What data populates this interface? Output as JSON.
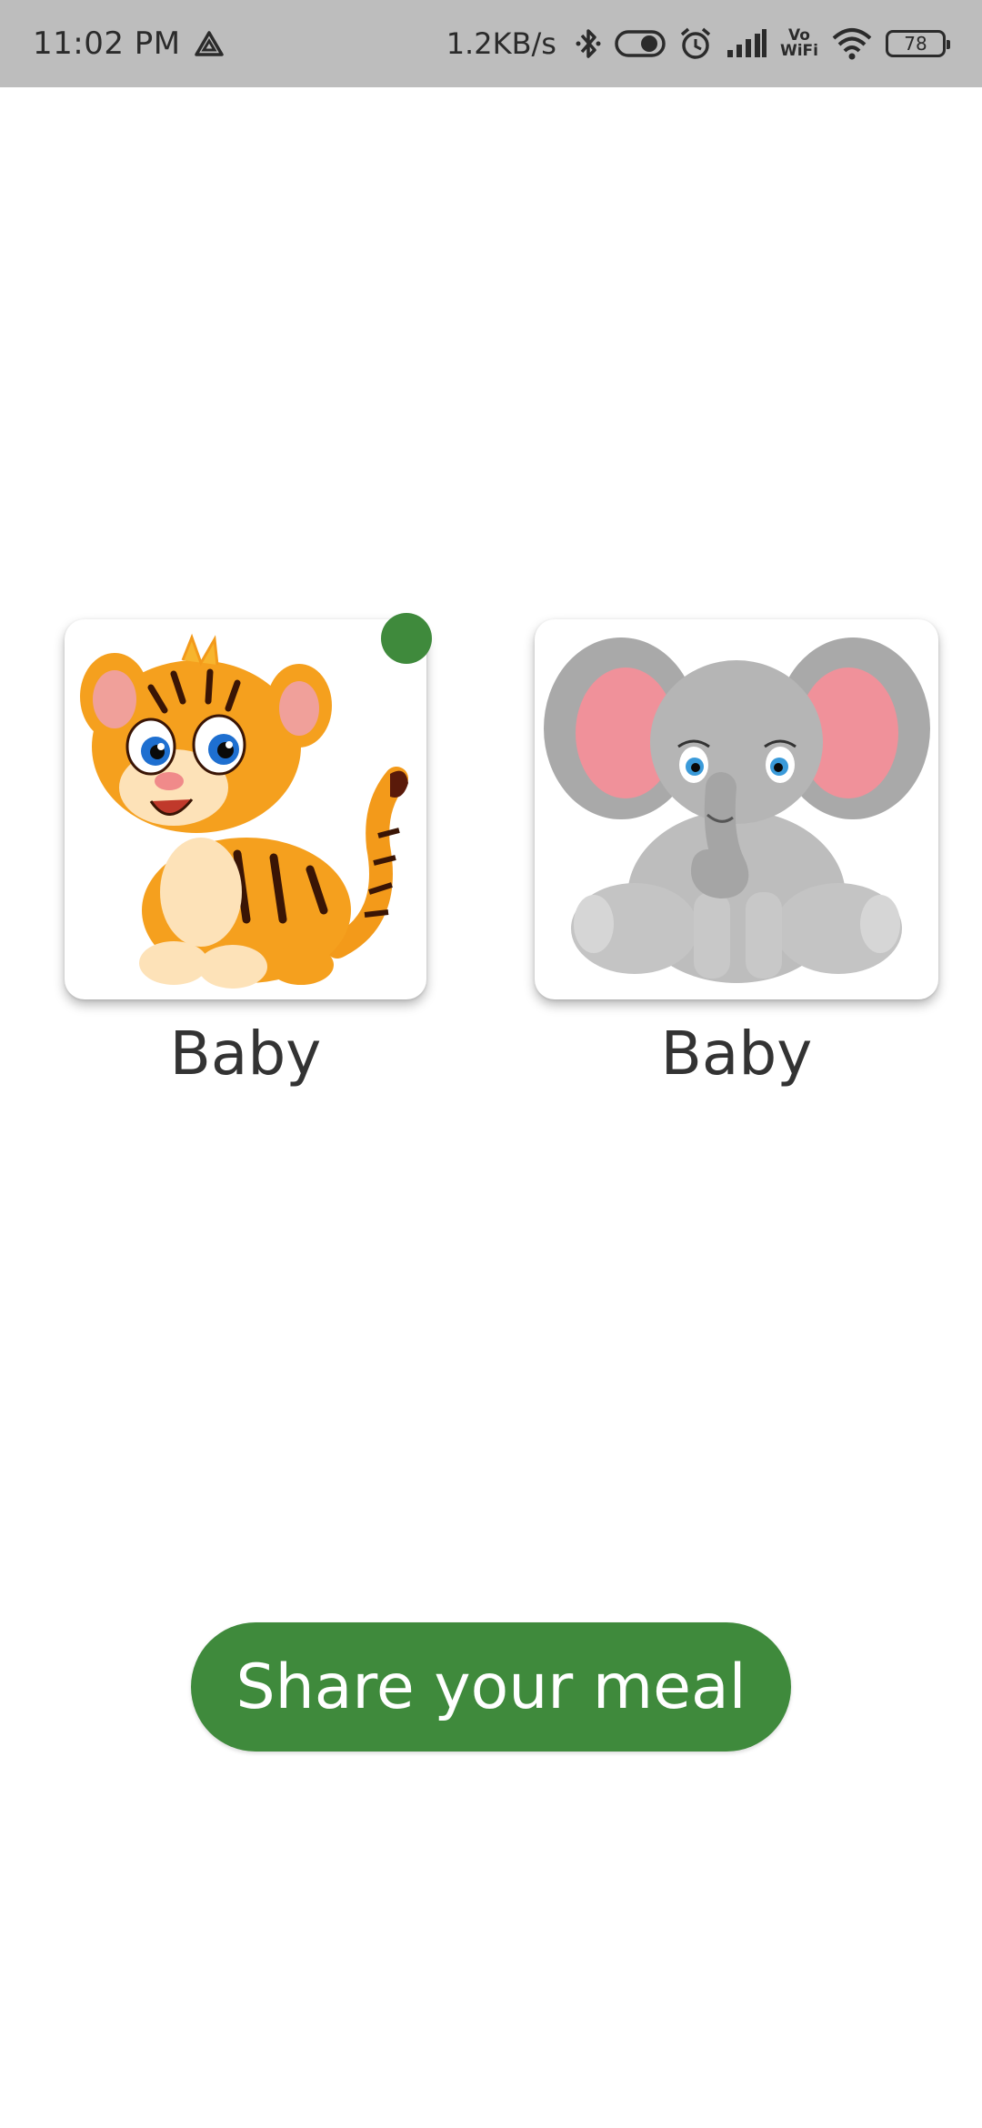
{
  "status_bar": {
    "time": "11:02 PM",
    "net_speed": "1.2KB/s",
    "vowifi_top": "Vo",
    "vowifi_bottom": "WiFi",
    "battery": "78",
    "icons": [
      "drive-icon",
      "bluetooth-icon",
      "toggle-icon",
      "alarm-icon",
      "signal-icon",
      "wifi-icon",
      "battery-icon"
    ]
  },
  "animals": [
    {
      "name": "tiger",
      "label": "Baby",
      "selected": true
    },
    {
      "name": "elephant",
      "label": "Baby",
      "selected": false
    }
  ],
  "share_button": {
    "label": "Share your meal"
  },
  "colors": {
    "accent": "#3f8a3c",
    "status_bar": "#bdbdbd",
    "label_text": "#333333"
  }
}
